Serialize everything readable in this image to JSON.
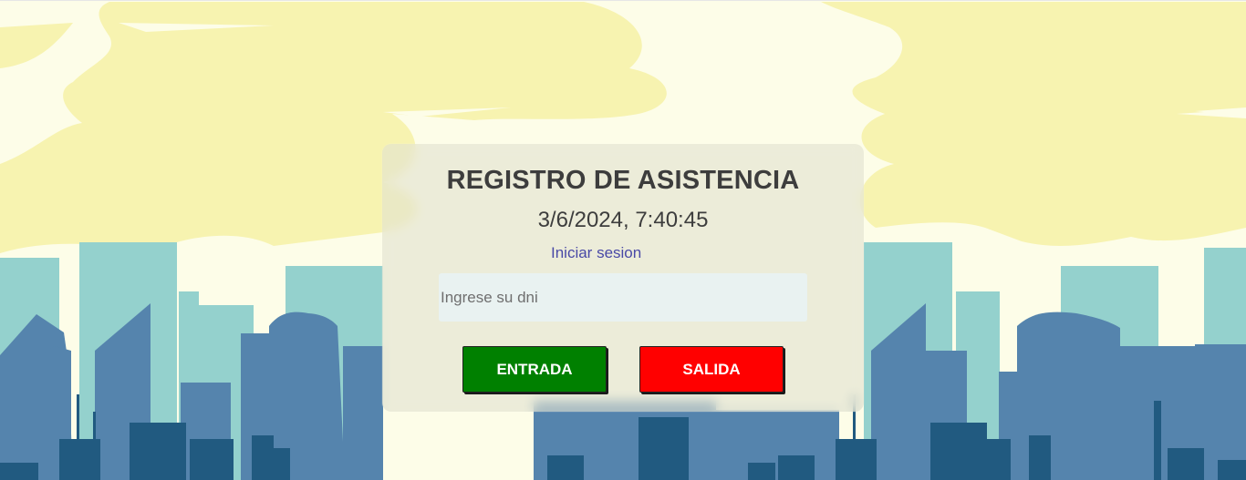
{
  "card": {
    "title": "REGISTRO DE ASISTENCIA",
    "datetime": "3/6/2024, 7:40:45",
    "login_link": "Iniciar sesion"
  },
  "dni_input": {
    "value": "",
    "placeholder": "Ingrese su dni"
  },
  "buttons": {
    "entrada": "ENTRADA",
    "salida": "SALIDA"
  },
  "colors": {
    "sky": "#fdfde8",
    "clouds": "#f7f3b0",
    "buildings_far": "#94d1cd",
    "buildings_mid": "#5584ad",
    "buildings_near": "#215a80",
    "entrada": "#008000",
    "salida": "#ff0000",
    "link": "#4949a6"
  }
}
